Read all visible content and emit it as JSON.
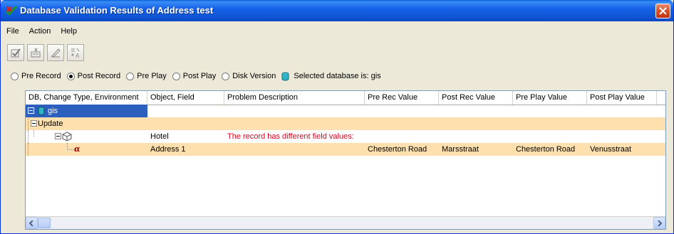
{
  "window": {
    "title": "Database Validation Results of Address test"
  },
  "menu": [
    "File",
    "Action",
    "Help"
  ],
  "toolbar": {
    "icons": [
      "validate-icon",
      "edit-record-icon",
      "pencil-icon",
      "reorder-icon"
    ]
  },
  "radios": [
    {
      "label": "Pre Record",
      "checked": false
    },
    {
      "label": "Post Record",
      "checked": true
    },
    {
      "label": "Pre Play",
      "checked": false
    },
    {
      "label": "Post Play",
      "checked": false
    },
    {
      "label": "Disk Version",
      "checked": false
    }
  ],
  "selected_db": {
    "text": "Selected database is: gis"
  },
  "grid": {
    "columns": [
      "DB, Change Type, Environment",
      "Object, Field",
      "Problem Description",
      "Pre Rec Value",
      "Post Rec Value",
      "Pre Play Value",
      "Post Play Value"
    ],
    "rows": [
      {
        "tree": "gis",
        "object": "",
        "problem": "",
        "pre_rec": "",
        "post_rec": "",
        "pre_play": "",
        "post_play": ""
      },
      {
        "tree": "Update",
        "object": "",
        "problem": "",
        "pre_rec": "",
        "post_rec": "",
        "pre_play": "",
        "post_play": ""
      },
      {
        "tree": "",
        "object": "Hotel",
        "problem": "The record has different field values:",
        "pre_rec": "",
        "post_rec": "",
        "pre_play": "",
        "post_play": ""
      },
      {
        "tree": "α",
        "object": "Address 1",
        "problem": "",
        "pre_rec": "Chesterton Road",
        "post_rec": "Marsstraat",
        "pre_play": "Chesterton Road",
        "post_play": "Venusstraat"
      }
    ]
  },
  "colors": {
    "titlebar": "#0f55d6",
    "row_highlight": "#fde0ad",
    "selection": "#2c5fbe",
    "problem_text": "#e0001b"
  }
}
